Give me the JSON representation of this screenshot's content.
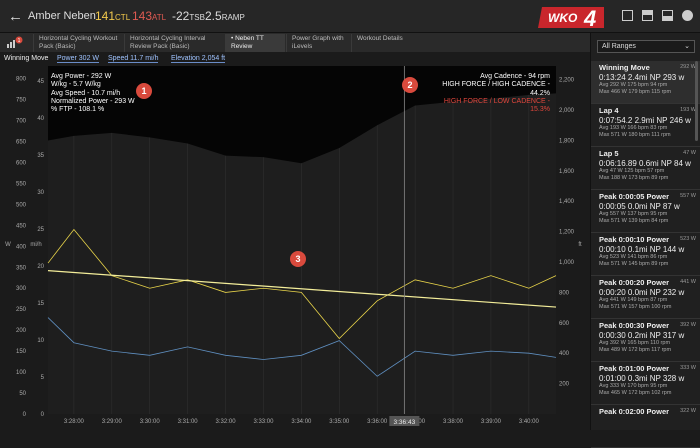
{
  "header": {
    "back_glyph": "←",
    "athlete": "Amber Neben",
    "ctl_value": "141",
    "ctl_unit": "CTL",
    "atl_value": "143",
    "atl_unit": "ATL",
    "tsb_value": "-22",
    "tsb_unit": "TSB",
    "ramp_value": "2.5",
    "ramp_unit": "RAMP",
    "logo_text": "WKO",
    "logo_number": "4",
    "icons": [
      "layout-full-icon",
      "layout-split-icon",
      "layout-stack-icon",
      "settings-icon"
    ]
  },
  "tabs": {
    "badge": "1",
    "items": [
      {
        "label": "Horizontal Cycling Workout Pack (Basic)"
      },
      {
        "label": "Horizontal Cycling Interval Review Pack (Basic)"
      },
      {
        "label": "• Neben TT Review"
      },
      {
        "label": "Power Graph with iLevels"
      },
      {
        "label": "Workout Details"
      }
    ]
  },
  "chart_header": {
    "name": "Winning Move",
    "power": "Power  302 W",
    "speed": "Speed  11.7 mi/h",
    "elevation": "Elevation  2,054 ft"
  },
  "annotations": {
    "badge1": "1",
    "badge2": "2",
    "badge3": "3",
    "left_lines": [
      "Avg Power - 292 W",
      "W/kg - 5.7 W/kg",
      "Avg Speed - 10.7 mi/h",
      "Normalized Power - 293 W",
      "% FTP - 108.1 %"
    ],
    "right_lines": [
      "Avg Cadence - 94 rpm",
      "HIGH FORCE / HIGH CADENCE - 44.2%"
    ],
    "right_red": "HIGH FORCE / LOW CADENCE - 15.3%"
  },
  "colors": {
    "power": "#e8d44a",
    "cadence": "#5f8fc0",
    "trend": "#f4ee9a",
    "elevation": "#050505",
    "badge": "#d94a3d"
  },
  "sidebar": {
    "range_select": "All Ranges",
    "items": [
      {
        "title": "Winning Move",
        "watt": "292 W",
        "main": "0:13:24  2.4mi  NP 293 w",
        "avg": "Avg  292 W   175 bpm   94 rpm",
        "max": "Max  466 W   179 bpm   115 rpm"
      },
      {
        "title": "Lap 4",
        "watt": "193 W",
        "main": "0:07:54.2  2.9mi  NP 246 w",
        "avg": "Avg  193 W   166 bpm   83 rpm",
        "max": "Max  571 W   180 bpm   111 rpm"
      },
      {
        "title": "Lap 5",
        "watt": "47 W",
        "main": "0:06:16.89  0.6mi  NP 84 w",
        "avg": "Avg  47 W   125 bpm   57 rpm",
        "max": "Max  188 W   173 bpm   89 rpm"
      },
      {
        "title": "Peak 0:00:05 Power",
        "watt": "557 W",
        "main": "0:00:05  0.0mi  NP 87 w",
        "avg": "Avg  557 W   137 bpm   95 rpm",
        "max": "Max  571 W   139 bpm   84 rpm"
      },
      {
        "title": "Peak 0:00:10 Power",
        "watt": "523 W",
        "main": "0:00:10  0.1mi  NP 144 w",
        "avg": "Avg  523 W   141 bpm   86 rpm",
        "max": "Max  571 W   145 bpm   89 rpm"
      },
      {
        "title": "Peak 0:00:20 Power",
        "watt": "441 W",
        "main": "0:00:20  0.0mi  NP 232 w",
        "avg": "Avg  441 W   149 bpm   87 rpm",
        "max": "Max  571 W   157 bpm   100 rpm"
      },
      {
        "title": "Peak 0:00:30 Power",
        "watt": "392 W",
        "main": "0:00:30  0.2mi  NP 317 w",
        "avg": "Avg  392 W   165 bpm   110 rpm",
        "max": "Max  489 W   172 bpm   117 rpm"
      },
      {
        "title": "Peak 0:01:00 Power",
        "watt": "333 W",
        "main": "0:01:00  0.3mi  NP 328 w",
        "avg": "Avg  333 W   170 bpm   95 rpm",
        "max": "Max  465 W   172 bpm   102 rpm"
      },
      {
        "title": "Peak 0:02:00 Power",
        "watt": "322 W",
        "main": "",
        "avg": "",
        "max": ""
      }
    ]
  },
  "chart_data": {
    "type": "line",
    "title": "",
    "xlabel": "",
    "x_tick_labels": [
      "3:28:00",
      "3:29:00",
      "3:30:00",
      "3:31:00",
      "3:32:00",
      "3:33:00",
      "3:34:00",
      "3:35:00",
      "3:36:00",
      "3:37:00",
      "3:38:00",
      "3:39:00",
      "3:40:00"
    ],
    "cursor_label": "3:36:43",
    "cursor_time": "3:36:43",
    "x_range": [
      "3:27:19",
      "3:40:43"
    ],
    "left_w_ticks": [
      "0",
      "50",
      "100",
      "150",
      "200",
      "250",
      "300",
      "350",
      "400",
      "450",
      "500",
      "550",
      "600",
      "650",
      "700",
      "750",
      "800"
    ],
    "left_w_label": "W",
    "left_w_range": [
      0,
      830
    ],
    "left_mph_ticks": [
      "0",
      "5",
      "10",
      "15",
      "20",
      "25",
      "30",
      "35",
      "40",
      "45"
    ],
    "left_mph_label": "mi/h",
    "left_mph_range": [
      0,
      47
    ],
    "right_ft_ticks": [
      "200",
      "400",
      "600",
      "800",
      "1,000",
      "1,200",
      "1,400",
      "1,600",
      "1,800",
      "2,000",
      "2,200"
    ],
    "right_ft_label": "ft",
    "right_ft_range": [
      0,
      2290
    ],
    "series": [
      {
        "unit": "ft",
        "x": [
          "3:27:19",
          "3:28:00",
          "3:29:00",
          "3:30:00",
          "3:31:00",
          "3:32:00",
          "3:33:00",
          "3:34:00",
          "3:35:00",
          "3:36:00",
          "3:37:00",
          "3:38:00",
          "3:39:00",
          "3:40:00",
          "3:40:43"
        ],
        "values": [
          1800,
          1830,
          1850,
          1820,
          1780,
          1700,
          1690,
          1650,
          1750,
          1900,
          2030,
          2055,
          2075,
          2100,
          2110
        ]
      },
      {
        "unit": "W",
        "x": [
          "3:27:19",
          "3:28:00",
          "3:29:00",
          "3:30:00",
          "3:31:00",
          "3:32:00",
          "3:33:00",
          "3:34:00",
          "3:35:00",
          "3:36:00",
          "3:37:00",
          "3:38:00",
          "3:39:00",
          "3:40:00",
          "3:40:43"
        ],
        "values": [
          360,
          440,
          330,
          300,
          320,
          290,
          300,
          290,
          180,
          270,
          320,
          300,
          330,
          300,
          330
        ]
      },
      {
        "unit": "W",
        "x": [
          "3:27:19",
          "3:40:43"
        ],
        "values": [
          342,
          255
        ]
      },
      {
        "unit": "rpm",
        "x": [
          "3:27:19",
          "3:28:00",
          "3:29:00",
          "3:30:00",
          "3:31:00",
          "3:32:00",
          "3:33:00",
          "3:34:00",
          "3:35:00",
          "3:36:00",
          "3:37:00",
          "3:38:00",
          "3:39:00",
          "3:40:00",
          "3:40:43"
        ],
        "values": [
          230,
          170,
          150,
          140,
          160,
          140,
          130,
          140,
          175,
          90,
          150,
          140,
          150,
          145,
          135
        ]
      }
    ]
  }
}
